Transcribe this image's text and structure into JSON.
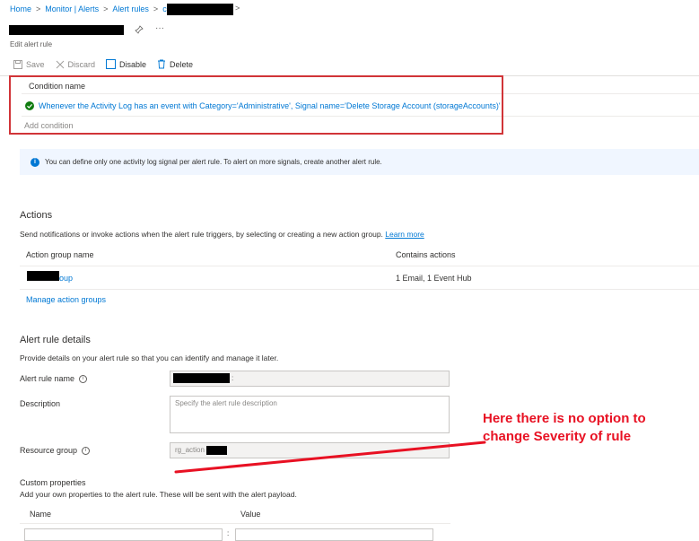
{
  "breadcrumb": {
    "items": [
      "Home",
      "Monitor | Alerts",
      "Alert rules"
    ],
    "last_visible_prefix": "c"
  },
  "page": {
    "subtitle": "Edit alert rule"
  },
  "toolbar": {
    "save_label": "Save",
    "discard_label": "Discard",
    "disable_label": "Disable",
    "delete_label": "Delete"
  },
  "condition": {
    "header": "Condition name",
    "text": "Whenever the Activity Log has an event with Category='Administrative', Signal name='Delete Storage Account (storageAccounts)'",
    "add_label": "Add condition"
  },
  "info_banner": {
    "text": "You can define only one activity log signal per alert rule. To alert on more signals, create another alert rule."
  },
  "actions": {
    "title": "Actions",
    "description": "Send notifications or invoke actions when the alert rule triggers, by selecting or creating a new action group.",
    "learn_more": "Learn more",
    "columns": [
      "Action group name",
      "Contains actions"
    ],
    "rows": [
      {
        "name_suffix": "oup",
        "contains": "1 Email, 1 Event Hub"
      }
    ],
    "manage_label": "Manage action groups"
  },
  "details": {
    "title": "Alert rule details",
    "description": "Provide details on your alert rule so that you can identify and manage it later.",
    "rule_name_label": "Alert rule name",
    "rule_name_suffix": ":",
    "description_label": "Description",
    "description_placeholder": "Specify the alert rule description",
    "resource_group_label": "Resource group",
    "resource_group_value": "rg_action"
  },
  "custom": {
    "title": "Custom properties",
    "description": "Add your own properties to the alert rule. These will be sent with the alert payload.",
    "name_col": "Name",
    "value_col": "Value"
  },
  "annotation": {
    "line1": "Here there is no option to",
    "line2": "change Severity of rule",
    "color": "#e81123"
  },
  "colors": {
    "accent": "#0078d4",
    "success": "#107c10",
    "highlight_box": "#d13438"
  }
}
